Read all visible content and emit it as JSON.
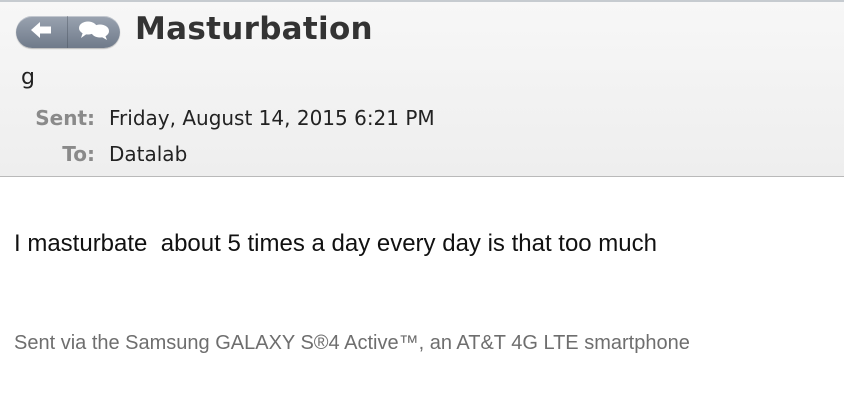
{
  "toolbar": {
    "back_icon": "back-arrow-icon",
    "reply_icon": "speech-bubbles-icon"
  },
  "message": {
    "subject": "Masturbation",
    "sender": "g",
    "sent_label": "Sent:",
    "sent_value": "Friday, August 14, 2015 6:21 PM",
    "to_label": "To:",
    "to_value": "Datalab",
    "body": "I masturbate  about 5 times a day every day is that too much",
    "signature": "Sent via the Samsung GALAXY S®4 Active™, an AT&T 4G LTE smartphone"
  },
  "colors": {
    "header_bg": "#f2f2f2",
    "nav_button": "#7f8a99",
    "label_gray": "#8a8a8a"
  }
}
